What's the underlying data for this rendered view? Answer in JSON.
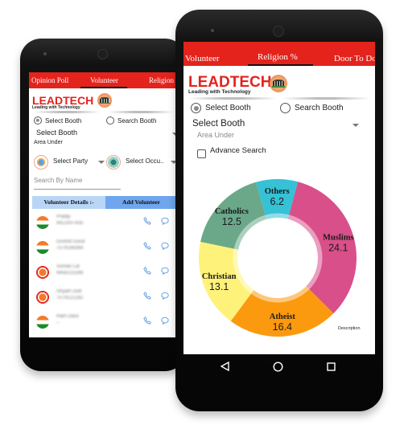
{
  "left_phone": {
    "tabs": [
      {
        "label": "Opinion Poll",
        "active": false
      },
      {
        "label": "Volunteer",
        "active": true
      },
      {
        "label": "Religion %",
        "active": false
      }
    ],
    "logo": {
      "brand": "LEADTECH",
      "tagline": "Leading with Technology"
    },
    "radio_select_booth": "Select Booth",
    "radio_search_booth": "Search Booth",
    "select_booth_value": "Select Booth",
    "area_under_label": "Area Under",
    "party_select": "Select Party",
    "occupation_select": "Select Occu..",
    "search_placeholder": "Search By Name",
    "volunteer_details_label": "Volunteer Details :-",
    "add_volunteer_label": "Add Volunteer",
    "volunteers": [
      {
        "name": "Pradip",
        "phone": "9412007435",
        "party": "congress"
      },
      {
        "name": "Govind Goud",
        "phone": "7579148364",
        "party": "congress"
      },
      {
        "name": "Suman Lal",
        "phone": "9458215266",
        "party": "bjp"
      },
      {
        "name": "Shyam Dutt",
        "phone": "7579121282",
        "party": "bjp"
      },
      {
        "name": "Ram Dass",
        "phone": "--",
        "party": "congress"
      }
    ]
  },
  "right_phone": {
    "tabs": [
      {
        "label": "Volunteer",
        "active": false
      },
      {
        "label": "Religion %",
        "active": true
      },
      {
        "label": "Door To Do",
        "active": false
      }
    ],
    "logo": {
      "brand": "LEADTECH",
      "tagline": "Leading with Technology"
    },
    "radio_select_booth": "Select Booth",
    "radio_search_booth": "Search Booth",
    "select_booth_value": "Select Booth",
    "area_under_label": "Area Under",
    "advance_search_label": "Advance Search",
    "chart_description": "Description",
    "nav": {
      "back": "back-icon",
      "home": "home-icon",
      "recents": "recents-icon"
    }
  },
  "colors": {
    "accent_red": "#e3231c",
    "header_light_blue": "#b9d6f7",
    "header_blue": "#6fa6ee",
    "icon_blue": "#4a90e2"
  },
  "chart_data": {
    "type": "pie",
    "donut": true,
    "title": "",
    "categories": [
      "Others",
      "Muslims",
      "Atheist",
      "Christian",
      "Catholics"
    ],
    "values": [
      6.2,
      24.1,
      16.4,
      13.1,
      12.5
    ],
    "colors": [
      "#36c1d6",
      "#d94f8a",
      "#fb9a0f",
      "#fff27a",
      "#6aa889"
    ],
    "legend": "none",
    "description": "Description"
  }
}
